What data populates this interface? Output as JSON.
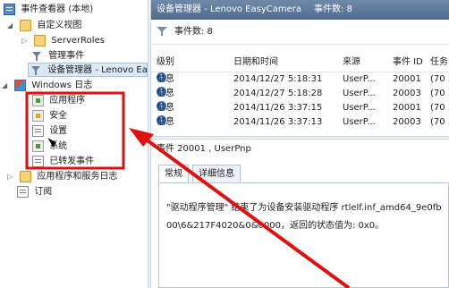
{
  "tree": {
    "root_label": "事件查看器 (本地)",
    "custom_views_label": "自定义视图",
    "server_roles_label": "ServerRoles",
    "admin_events_label": "管理事件",
    "device_manager_label": "设备管理器 - Lenovo Ea",
    "windows_logs_label": "Windows 日志",
    "windows_logs_items": [
      "应用程序",
      "安全",
      "设置",
      "系统",
      "已转发事件"
    ],
    "apps_services_label": "应用程序和服务日志",
    "subscriptions_label": "订阅"
  },
  "header": {
    "title": "设备管理器 - Lenovo EasyCamera",
    "count_text": "事件数: 8"
  },
  "filter": {
    "text": "事件数: 8"
  },
  "grid": {
    "columns": [
      "级别",
      "日期和时间",
      "来源",
      "事件 ID",
      "任务"
    ],
    "rows": [
      {
        "level": "信息",
        "datetime": "2014/12/27 5:18:31",
        "source": "UserP...",
        "event_id": "20001",
        "task": "(70"
      },
      {
        "level": "信息",
        "datetime": "2014/12/27 5:18:28",
        "source": "UserP...",
        "event_id": "20003",
        "task": "(70"
      },
      {
        "level": "信息",
        "datetime": "2014/11/26 3:37:15",
        "source": "UserP...",
        "event_id": "20001",
        "task": "(70"
      },
      {
        "level": "信息",
        "datetime": "2014/11/26 3:37:13",
        "source": "UserP...",
        "event_id": "20003",
        "task": "(70"
      }
    ]
  },
  "detail": {
    "title": "事件 20001 , UserPnp",
    "tab_general": "常规",
    "tab_details": "详细信息",
    "message_line1": "\"驱动程序管理\" 结束了为设备安装驱动程序 rtlelf.inf_amd64_9e0fb",
    "message_line2": "00\\6&217F4020&0&0000，返回的状态值为: 0x0。"
  },
  "colors": {
    "titlebar": "#4e6b8f",
    "annotation_red": "#e01010",
    "info_icon": "#2f6fc9"
  }
}
